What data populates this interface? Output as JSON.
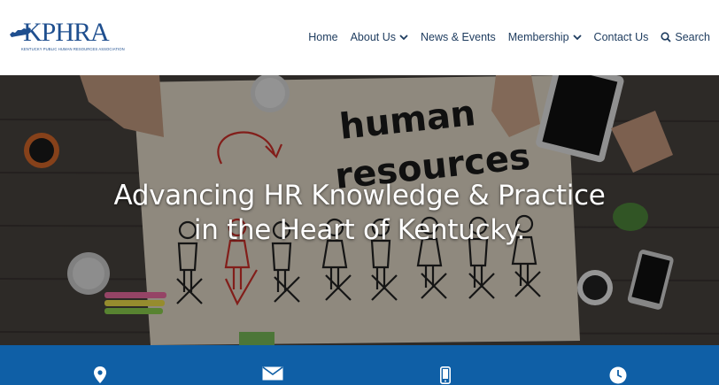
{
  "logo": {
    "name": "KPHRA",
    "tagline": "KENTUCKY PUBLIC HUMAN RESOURCES ASSOCIATION",
    "brand_color": "#1f4f8f"
  },
  "nav": {
    "items": [
      {
        "label": "Home",
        "dropdown": false
      },
      {
        "label": "About Us",
        "dropdown": true
      },
      {
        "label": "News & Events",
        "dropdown": false
      },
      {
        "label": "Membership",
        "dropdown": true
      },
      {
        "label": "Contact Us",
        "dropdown": false
      }
    ],
    "search_label": "Search",
    "text_color": "#1d3b5e"
  },
  "hero": {
    "title_line1": "Advancing HR Knowledge & Practice",
    "title_line2": "in the Heart of Kentucky.",
    "art_text_1": "human",
    "art_text_2": "resources"
  },
  "infobar": {
    "background": "#0f5fa6",
    "icons": [
      "location-pin-icon",
      "envelope-icon",
      "mobile-phone-icon",
      "clock-icon"
    ]
  }
}
